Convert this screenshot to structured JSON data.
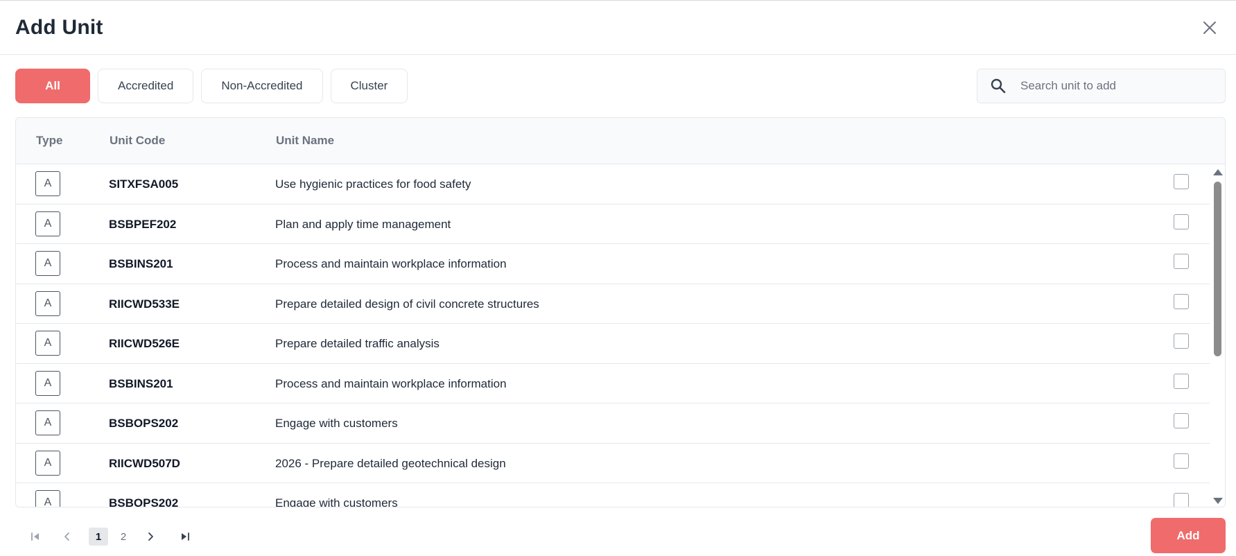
{
  "dialog": {
    "title": "Add Unit"
  },
  "filters": [
    {
      "label": "All",
      "active": true
    },
    {
      "label": "Accredited",
      "active": false
    },
    {
      "label": "Non-Accredited",
      "active": false
    },
    {
      "label": "Cluster",
      "active": false
    }
  ],
  "search": {
    "placeholder": "Search unit to add",
    "value": ""
  },
  "table": {
    "columns": [
      "Type",
      "Unit Code",
      "Unit Name"
    ],
    "rows": [
      {
        "type": "A",
        "code": "SITXFSA005",
        "name": "Use hygienic practices for food safety",
        "checked": false
      },
      {
        "type": "A",
        "code": "BSBPEF202",
        "name": "Plan and apply time management",
        "checked": false
      },
      {
        "type": "A",
        "code": "BSBINS201",
        "name": "Process and maintain workplace information",
        "checked": false
      },
      {
        "type": "A",
        "code": "RIICWD533E",
        "name": "Prepare detailed design of civil concrete structures",
        "checked": false
      },
      {
        "type": "A",
        "code": "RIICWD526E",
        "name": "Prepare detailed traffic analysis",
        "checked": false
      },
      {
        "type": "A",
        "code": "BSBINS201",
        "name": "Process and maintain workplace information",
        "checked": false
      },
      {
        "type": "A",
        "code": "BSBOPS202",
        "name": "Engage with customers",
        "checked": false
      },
      {
        "type": "A",
        "code": "RIICWD507D",
        "name": "2026 - Prepare detailed geotechnical design",
        "checked": false
      },
      {
        "type": "A",
        "code": "BSBOPS202",
        "name": "Engage with customers",
        "checked": false
      }
    ]
  },
  "pagination": {
    "pages": [
      "1",
      "2"
    ],
    "current": "1"
  },
  "footer": {
    "add_label": "Add"
  },
  "colors": {
    "accent": "#f06b6b",
    "border": "#e5e7eb",
    "header_bg": "#f9fafb"
  },
  "icons": {
    "close": "close-icon",
    "search": "search-icon",
    "first_page": "first-page-icon",
    "prev_page": "chevron-left-icon",
    "next_page": "chevron-right-icon",
    "last_page": "last-page-icon"
  }
}
